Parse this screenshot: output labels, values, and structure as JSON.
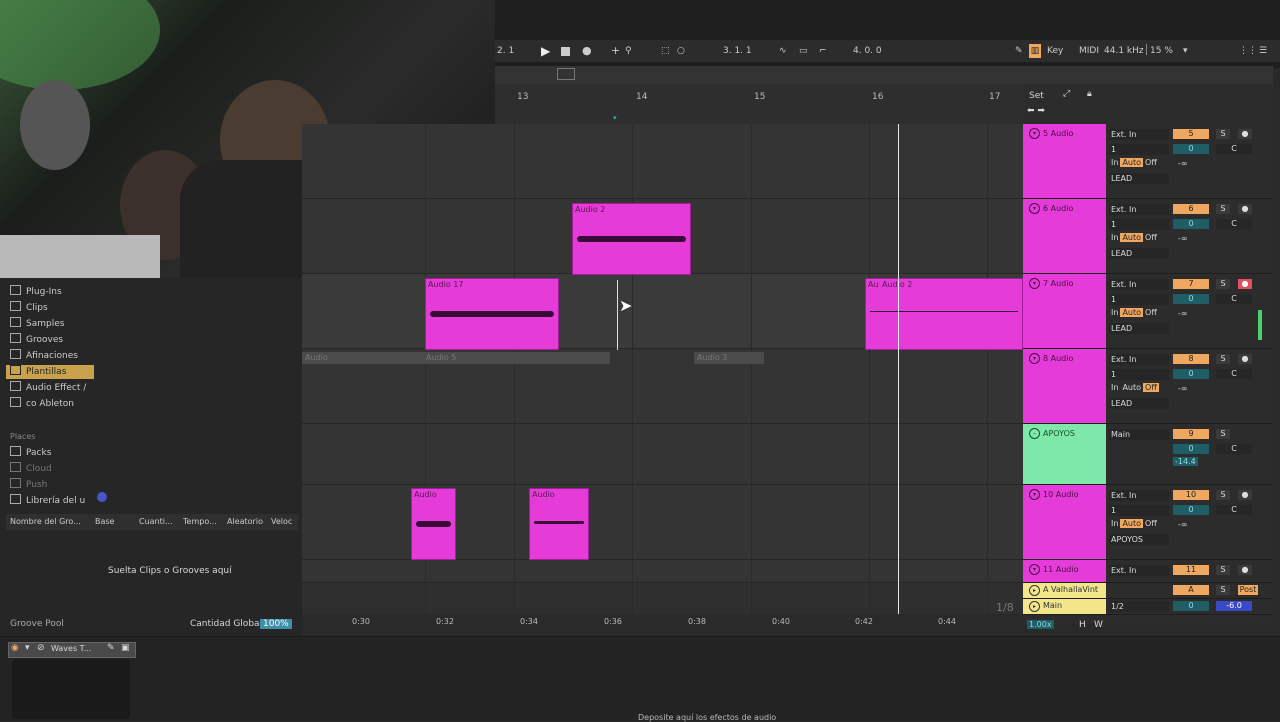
{
  "transport": {
    "pos_left": "2. 1",
    "song_pos": "3.   1.   1",
    "loop_len": "4.   0.   0",
    "key_label": "Key",
    "midi_label": "MIDI",
    "sample_rate": "44.1 kHz",
    "cpu": "15 %"
  },
  "ruler": {
    "bars": [
      "13",
      "14",
      "15",
      "16",
      "17"
    ],
    "set_label": "Set"
  },
  "tracks": [
    {
      "name": "5 Audio",
      "input": "Ext. In",
      "channel": "1",
      "number": "5",
      "vol": "0",
      "pan": "C",
      "solo": "S",
      "route": "LEAD",
      "mon": [
        "In",
        "Auto",
        "Off"
      ],
      "db": "-∞"
    },
    {
      "name": "6 Audio",
      "input": "Ext. In",
      "channel": "1",
      "number": "6",
      "vol": "0",
      "pan": "C",
      "solo": "S",
      "route": "LEAD",
      "mon": [
        "In",
        "Auto",
        "Off"
      ],
      "db": "-∞"
    },
    {
      "name": "7 Audio",
      "input": "Ext. In",
      "channel": "1",
      "number": "7",
      "vol": "0",
      "pan": "C",
      "solo": "S",
      "route": "LEAD",
      "mon": [
        "In",
        "Auto",
        "Off"
      ],
      "db": "-∞"
    },
    {
      "name": "8 Audio",
      "input": "Ext. In",
      "channel": "1",
      "number": "8",
      "vol": "0",
      "pan": "C",
      "solo": "S",
      "route": "LEAD",
      "mon": [
        "In",
        "Auto",
        "Off"
      ],
      "db": "-∞"
    },
    {
      "name": "APOYOS",
      "input": "Main",
      "channel": "",
      "number": "9",
      "vol": "0",
      "pan": "C",
      "solo": "S",
      "route": "",
      "mon": [],
      "db": "-14.4"
    },
    {
      "name": "10 Audio",
      "input": "Ext. In",
      "channel": "1",
      "number": "10",
      "vol": "0",
      "pan": "C",
      "solo": "S",
      "route": "APOYOS",
      "mon": [
        "In",
        "Auto",
        "Off"
      ],
      "db": "-∞"
    },
    {
      "name": "11 Audio",
      "input": "Ext. In",
      "channel": "",
      "number": "11",
      "vol": "",
      "pan": "",
      "solo": "S",
      "route": "",
      "mon": [],
      "db": ""
    }
  ],
  "returns": {
    "a_name": "A ValhallaVint",
    "a_label": "A",
    "a_solo": "S",
    "a_post": "Post",
    "main_name": "Main",
    "main_route": "1/2",
    "main_vol": "0",
    "main_db": "-6.0",
    "quant": "1/8"
  },
  "clips": {
    "c1": "Audio 2",
    "c2": "Audio 17",
    "c3": "Audio 2",
    "c3b": "Au",
    "c4": "Audio",
    "c5": "Audio",
    "g1": "Audio",
    "g2": "Audio 5",
    "g3": "Audio 3"
  },
  "timeaxis": [
    "0:30",
    "0:32",
    "0:34",
    "0:36",
    "0:38",
    "0:40",
    "0:42",
    "0:44"
  ],
  "browser": {
    "items": [
      "Plug-Ins",
      "Clips",
      "Samples",
      "Grooves",
      "Afinaciones",
      "Plantillas",
      "Audio Effect /",
      "co Ableton"
    ],
    "places_title": "Places",
    "places": [
      "Packs",
      "Cloud",
      "Push",
      "Librería del u"
    ],
    "gp_cols": [
      "Nombre del Gro...",
      "Base",
      "Cuanti...",
      "Tempo...",
      "Aleatorio",
      "Veloc"
    ],
    "gp_empty": "Suelta Clips o Grooves aquí",
    "gp_title": "Groove Pool",
    "gp_global": "Cantidad Global",
    "gp_pct": "100%"
  },
  "bottom": {
    "device": "Waves T...",
    "drop_hint": "Deposite aquí los efectos de audio",
    "zoom": "1.00x",
    "h": "H",
    "w": "W"
  }
}
